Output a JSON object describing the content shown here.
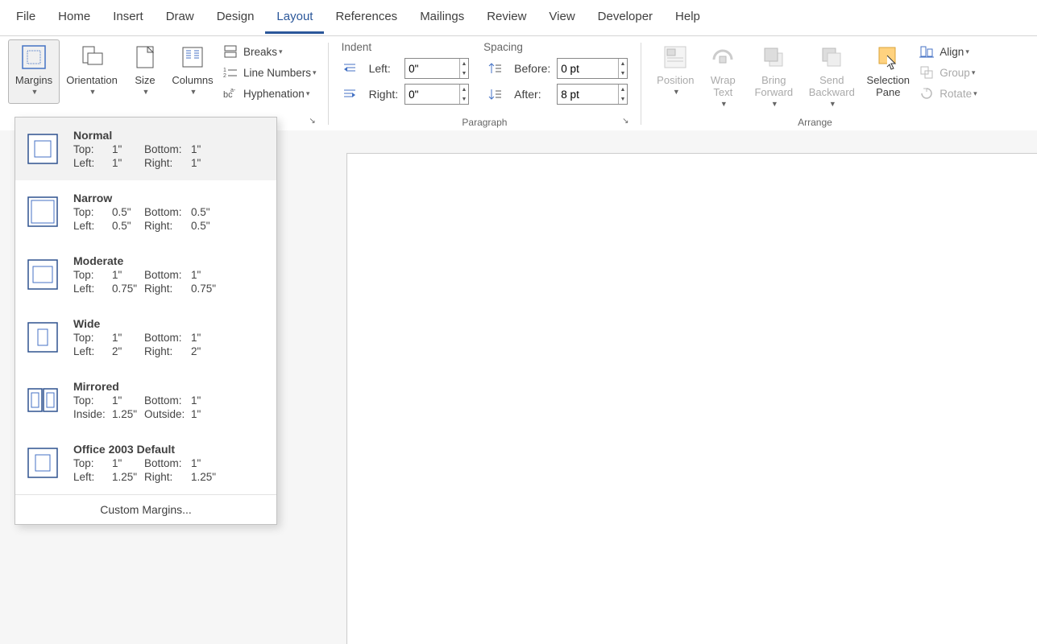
{
  "tabs": [
    "File",
    "Home",
    "Insert",
    "Draw",
    "Design",
    "Layout",
    "References",
    "Mailings",
    "Review",
    "View",
    "Developer",
    "Help"
  ],
  "activeTab": "Layout",
  "pageSetup": {
    "margins": "Margins",
    "orientation": "Orientation",
    "size": "Size",
    "columns": "Columns",
    "breaks": "Breaks",
    "lineNumbers": "Line Numbers",
    "hyphenation": "Hyphenation"
  },
  "paragraph": {
    "group": "Paragraph",
    "indentHead": "Indent",
    "spacingHead": "Spacing",
    "leftLabel": "Left:",
    "rightLabel": "Right:",
    "beforeLabel": "Before:",
    "afterLabel": "After:",
    "leftVal": "0\"",
    "rightVal": "0\"",
    "beforeVal": "0 pt",
    "afterVal": "8 pt"
  },
  "arrange": {
    "group": "Arrange",
    "position": "Position",
    "wrap": "Wrap Text",
    "forward": "Bring Forward",
    "backward": "Send Backward",
    "selpane": "Selection Pane",
    "align": "Align",
    "groupBtn": "Group",
    "rotate": "Rotate"
  },
  "marginsMenu": {
    "items": [
      {
        "name": "Normal",
        "l1a": "Top:",
        "l1b": "1\"",
        "l1c": "Bottom:",
        "l1d": "1\"",
        "l2a": "Left:",
        "l2b": "1\"",
        "l2c": "Right:",
        "l2d": "1\""
      },
      {
        "name": "Narrow",
        "l1a": "Top:",
        "l1b": "0.5\"",
        "l1c": "Bottom:",
        "l1d": "0.5\"",
        "l2a": "Left:",
        "l2b": "0.5\"",
        "l2c": "Right:",
        "l2d": "0.5\""
      },
      {
        "name": "Moderate",
        "l1a": "Top:",
        "l1b": "1\"",
        "l1c": "Bottom:",
        "l1d": "1\"",
        "l2a": "Left:",
        "l2b": "0.75\"",
        "l2c": "Right:",
        "l2d": "0.75\""
      },
      {
        "name": "Wide",
        "l1a": "Top:",
        "l1b": "1\"",
        "l1c": "Bottom:",
        "l1d": "1\"",
        "l2a": "Left:",
        "l2b": "2\"",
        "l2c": "Right:",
        "l2d": "2\""
      },
      {
        "name": "Mirrored",
        "l1a": "Top:",
        "l1b": "1\"",
        "l1c": "Bottom:",
        "l1d": "1\"",
        "l2a": "Inside:",
        "l2b": "1.25\"",
        "l2c": "Outside:",
        "l2d": "1\""
      },
      {
        "name": "Office 2003 Default",
        "l1a": "Top:",
        "l1b": "1\"",
        "l1c": "Bottom:",
        "l1d": "1\"",
        "l2a": "Left:",
        "l2b": "1.25\"",
        "l2c": "Right:",
        "l2d": "1.25\""
      }
    ],
    "custom": "Custom Margins..."
  }
}
